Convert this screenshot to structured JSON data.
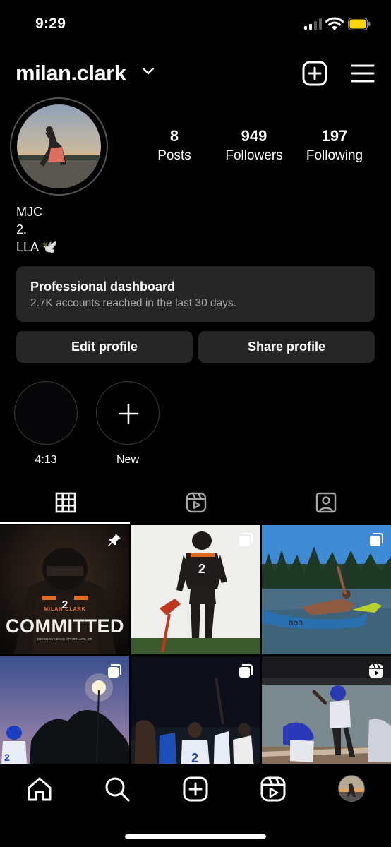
{
  "status_bar": {
    "time": "9:29"
  },
  "header": {
    "username": "milan.clark"
  },
  "stats": {
    "posts": {
      "count": "8",
      "label": "Posts"
    },
    "followers": {
      "count": "949",
      "label": "Followers"
    },
    "following": {
      "count": "197",
      "label": "Following"
    }
  },
  "bio": {
    "name": "MJC",
    "line2": "2.",
    "line3": "LLA 🕊️"
  },
  "dashboard": {
    "title": "Professional dashboard",
    "subtitle": "2.7K accounts reached in the last 30 days."
  },
  "buttons": {
    "edit": "Edit profile",
    "share": "Share profile"
  },
  "highlights": [
    {
      "label": "4:13"
    },
    {
      "label": "New"
    }
  ],
  "grid_overlay": {
    "name": "MILAN CLARK",
    "word": "COMMITTED",
    "sub": "DEFENSIVE BACK // PORTLAND, OR",
    "jersey": "2",
    "kayak": "BOB"
  },
  "icons": {
    "new_post": "plus-square-icon",
    "menu": "hamburger-icon",
    "posts_tab": "grid-icon",
    "reels_tab": "reels-icon",
    "tagged_tab": "tagged-icon",
    "home": "home-icon",
    "search": "search-icon",
    "create": "create-icon",
    "reels": "reels-icon",
    "pinned": "pin-icon",
    "carousel": "carousel-icon"
  },
  "colors": {
    "background": "#000000",
    "surface": "#262626",
    "secondary_text": "#a8a8a8",
    "battery": "#ffd60a"
  }
}
